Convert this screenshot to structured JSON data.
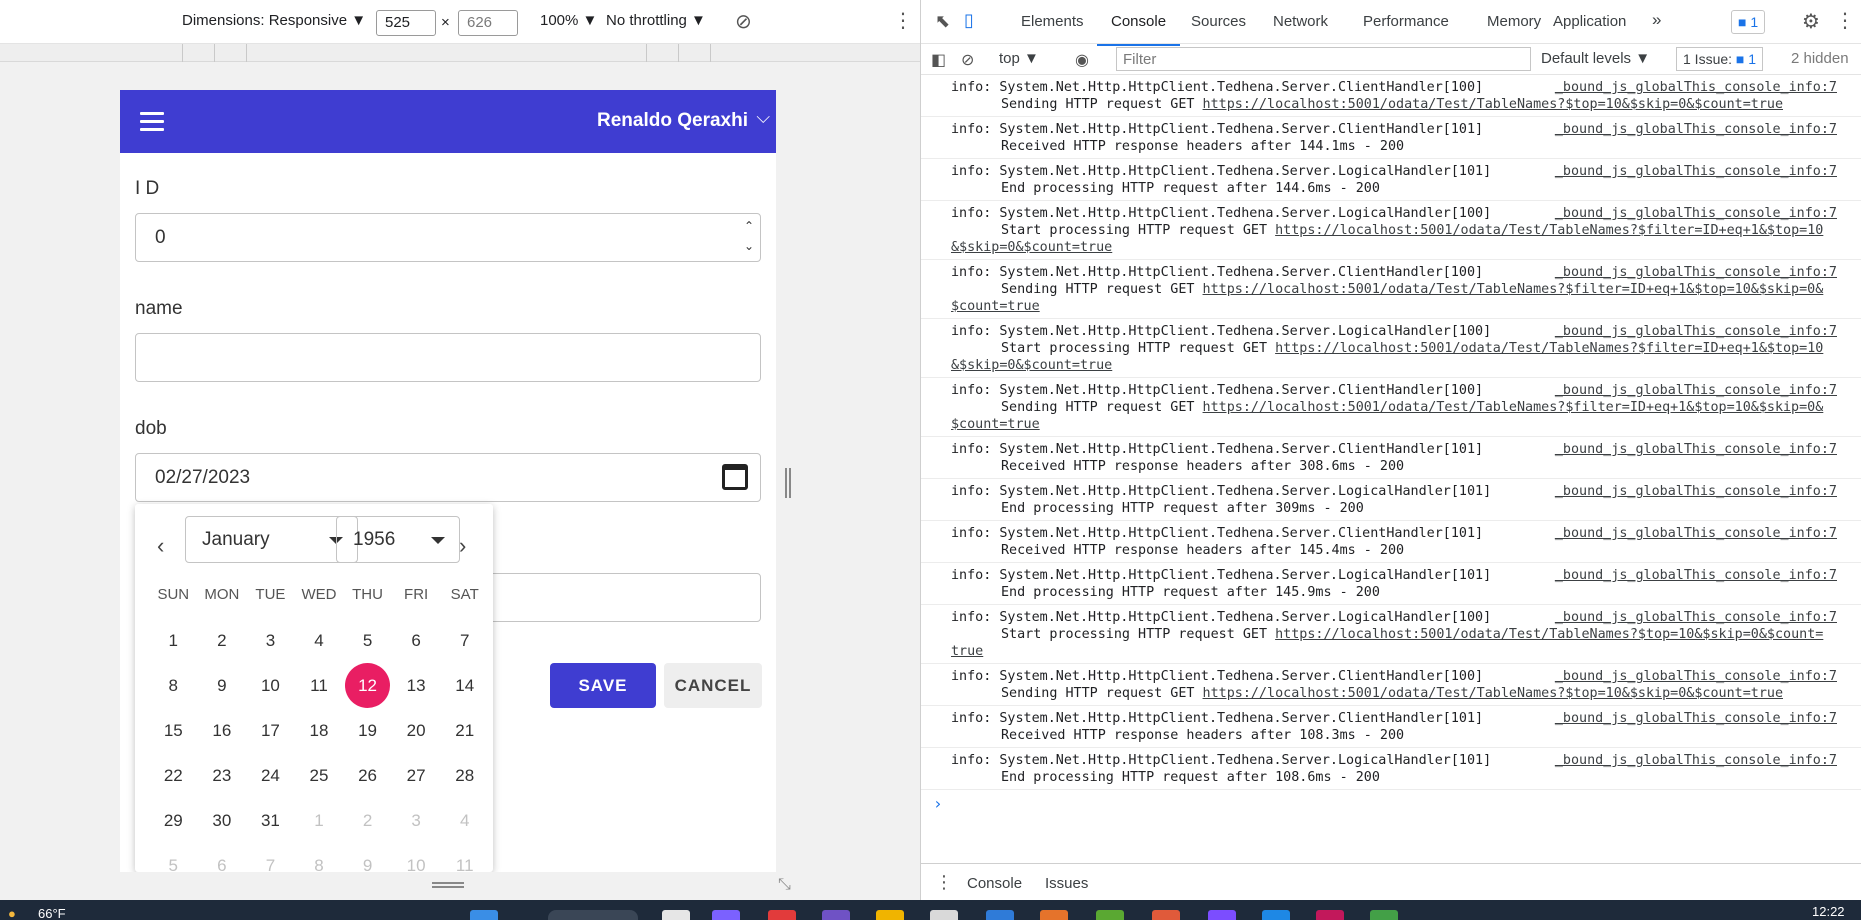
{
  "device_toolbar": {
    "dimensions_label": "Dimensions: Responsive ▼",
    "width_value": "525",
    "times": "×",
    "height_value": "626",
    "zoom": "100% ▼",
    "throttling": "No throttling ▼"
  },
  "app": {
    "user_name": "Renaldo Qeraxhi",
    "fields": {
      "id_label": "I D",
      "id_value": "0",
      "name_label": "name",
      "name_value": "",
      "dob_label": "dob",
      "dob_value": "02/27/2023"
    },
    "save_label": "SAVE",
    "cancel_label": "CANCEL",
    "calendar": {
      "month": "January",
      "year": "1956",
      "weekdays": [
        "SUN",
        "MON",
        "TUE",
        "WED",
        "THU",
        "FRI",
        "SAT"
      ],
      "days": [
        "1",
        "2",
        "3",
        "4",
        "5",
        "6",
        "7",
        "8",
        "9",
        "10",
        "11",
        "12",
        "13",
        "14",
        "15",
        "16",
        "17",
        "18",
        "19",
        "20",
        "21",
        "22",
        "23",
        "24",
        "25",
        "26",
        "27",
        "28",
        "29",
        "30",
        "31",
        "1",
        "2",
        "3",
        "4",
        "5",
        "6",
        "7",
        "8",
        "9",
        "10",
        "11"
      ],
      "selected_day": "12"
    }
  },
  "devtools": {
    "tabs": [
      "Elements",
      "Console",
      "Sources",
      "Network",
      "Performance",
      "Memory",
      "Application"
    ],
    "active_tab": "Console",
    "more_tabs": "»",
    "message_badge": "1",
    "context": "top",
    "filter_placeholder": "Filter",
    "default_levels": "Default levels ▼",
    "issues_label": "1 Issue:",
    "issues_count": "1",
    "hidden_label": "2 hidden",
    "console_lines": [
      {
        "head": "info: System.Net.Http.HttpClient.Tedhena.Server.ClientHandler[100]",
        "src": "_bound_js_globalThis_console_info:7",
        "body": "Sending HTTP request GET ",
        "link": "https://localhost:5001/odata/Test/TableNames?$top=10&$skip=0&$count=true",
        "cont": ""
      },
      {
        "head": "info: System.Net.Http.HttpClient.Tedhena.Server.ClientHandler[101]",
        "src": "_bound_js_globalThis_console_info:7",
        "body": "Received HTTP response headers after 144.1ms - 200",
        "link": "",
        "cont": ""
      },
      {
        "head": "info: System.Net.Http.HttpClient.Tedhena.Server.LogicalHandler[101]",
        "src": "_bound_js_globalThis_console_info:7",
        "body": "End processing HTTP request after 144.6ms - 200",
        "link": "",
        "cont": ""
      },
      {
        "head": "info: System.Net.Http.HttpClient.Tedhena.Server.LogicalHandler[100]",
        "src": "_bound_js_globalThis_console_info:7",
        "body": "Start processing HTTP request GET ",
        "link": "https://localhost:5001/odata/Test/TableNames?$filter=ID+eq+1&$top=10",
        "cont": "&$skip=0&$count=true"
      },
      {
        "head": "info: System.Net.Http.HttpClient.Tedhena.Server.ClientHandler[100]",
        "src": "_bound_js_globalThis_console_info:7",
        "body": "Sending HTTP request GET ",
        "link": "https://localhost:5001/odata/Test/TableNames?$filter=ID+eq+1&$top=10&$skip=0&",
        "cont": "$count=true"
      },
      {
        "head": "info: System.Net.Http.HttpClient.Tedhena.Server.LogicalHandler[100]",
        "src": "_bound_js_globalThis_console_info:7",
        "body": "Start processing HTTP request GET ",
        "link": "https://localhost:5001/odata/Test/TableNames?$filter=ID+eq+1&$top=10",
        "cont": "&$skip=0&$count=true"
      },
      {
        "head": "info: System.Net.Http.HttpClient.Tedhena.Server.ClientHandler[100]",
        "src": "_bound_js_globalThis_console_info:7",
        "body": "Sending HTTP request GET ",
        "link": "https://localhost:5001/odata/Test/TableNames?$filter=ID+eq+1&$top=10&$skip=0&",
        "cont": "$count=true"
      },
      {
        "head": "info: System.Net.Http.HttpClient.Tedhena.Server.ClientHandler[101]",
        "src": "_bound_js_globalThis_console_info:7",
        "body": "Received HTTP response headers after 308.6ms - 200",
        "link": "",
        "cont": ""
      },
      {
        "head": "info: System.Net.Http.HttpClient.Tedhena.Server.LogicalHandler[101]",
        "src": "_bound_js_globalThis_console_info:7",
        "body": "End processing HTTP request after 309ms - 200",
        "link": "",
        "cont": ""
      },
      {
        "head": "info: System.Net.Http.HttpClient.Tedhena.Server.ClientHandler[101]",
        "src": "_bound_js_globalThis_console_info:7",
        "body": "Received HTTP response headers after 145.4ms - 200",
        "link": "",
        "cont": ""
      },
      {
        "head": "info: System.Net.Http.HttpClient.Tedhena.Server.LogicalHandler[101]",
        "src": "_bound_js_globalThis_console_info:7",
        "body": "End processing HTTP request after 145.9ms - 200",
        "link": "",
        "cont": ""
      },
      {
        "head": "info: System.Net.Http.HttpClient.Tedhena.Server.LogicalHandler[100]",
        "src": "_bound_js_globalThis_console_info:7",
        "body": "Start processing HTTP request GET ",
        "link": "https://localhost:5001/odata/Test/TableNames?$top=10&$skip=0&$count=",
        "cont": "true"
      },
      {
        "head": "info: System.Net.Http.HttpClient.Tedhena.Server.ClientHandler[100]",
        "src": "_bound_js_globalThis_console_info:7",
        "body": "Sending HTTP request GET ",
        "link": "https://localhost:5001/odata/Test/TableNames?$top=10&$skip=0&$count=true",
        "cont": ""
      },
      {
        "head": "info: System.Net.Http.HttpClient.Tedhena.Server.ClientHandler[101]",
        "src": "_bound_js_globalThis_console_info:7",
        "body": "Received HTTP response headers after 108.3ms - 200",
        "link": "",
        "cont": ""
      },
      {
        "head": "info: System.Net.Http.HttpClient.Tedhena.Server.LogicalHandler[101]",
        "src": "_bound_js_globalThis_console_info:7",
        "body": "End processing HTTP request after 108.6ms - 200",
        "link": "",
        "cont": ""
      }
    ],
    "prompt": "›",
    "drawer_tabs": [
      "Console",
      "Issues"
    ]
  },
  "taskbar": {
    "weather": "66°F",
    "time": "12:22"
  }
}
